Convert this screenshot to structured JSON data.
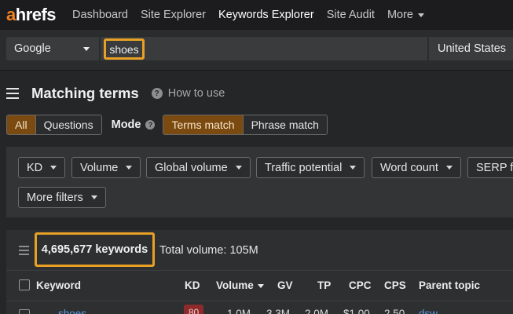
{
  "nav": {
    "logo_a": "a",
    "logo_rest": "hrefs",
    "links": [
      "Dashboard",
      "Site Explorer",
      "Keywords Explorer",
      "Site Audit"
    ],
    "more": "More"
  },
  "search": {
    "engine": "Google",
    "query": "shoes",
    "country": "United States"
  },
  "heading": {
    "title": "Matching terms",
    "help": "How to use"
  },
  "mode": {
    "scope_all": "All",
    "scope_questions": "Questions",
    "label": "Mode",
    "terms_match": "Terms match",
    "phrase_match": "Phrase match"
  },
  "filters": [
    "KD",
    "Volume",
    "Global volume",
    "Traffic potential",
    "Word count",
    "SERP features",
    "More filters"
  ],
  "results": {
    "keyword_count": "4,695,677 keywords",
    "total_volume": "Total volume: 105M"
  },
  "columns": {
    "keyword": "Keyword",
    "kd": "KD",
    "volume": "Volume",
    "gv": "GV",
    "tp": "TP",
    "cpc": "CPC",
    "cps": "CPS",
    "parent_topic": "Parent topic"
  },
  "first_row": {
    "keyword": "shoes",
    "kd": "80",
    "volume": "1.0M",
    "gv": "3.3M",
    "tp": "2.0M",
    "cpc": "$1.00",
    "cps": "2.50",
    "parent_topic": "dsw"
  },
  "colors": {
    "accent": "#e8a125",
    "logo_a": "#f58220",
    "active_segment": "#7a4a10",
    "kd_badge": "#8e2a2a",
    "link": "#5b9bde"
  }
}
